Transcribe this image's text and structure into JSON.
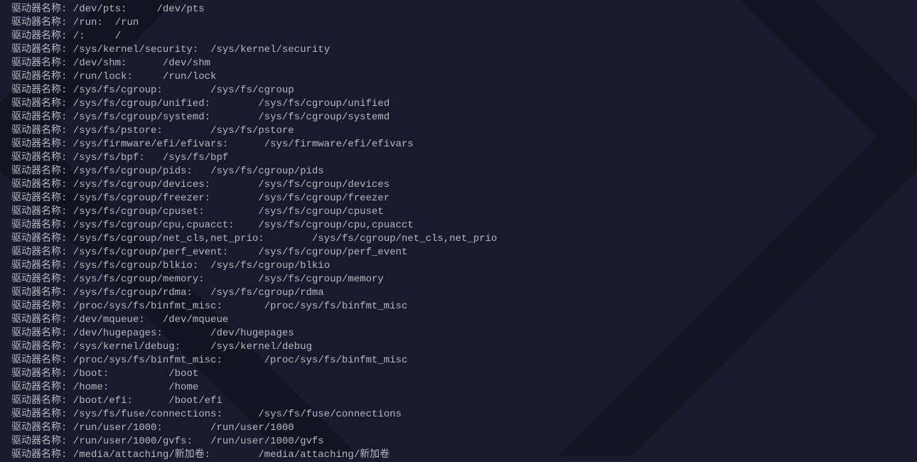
{
  "label_prefix": "驱动器名称:",
  "lines": [
    {
      "p1": "/dev/pts:",
      "pad": 5,
      "p2": "/dev/pts"
    },
    {
      "p1": "/run:",
      "pad": 2,
      "p2": "/run"
    },
    {
      "p1": "/:",
      "pad": 5,
      "p2": "/"
    },
    {
      "p1": "/sys/kernel/security:",
      "pad": 2,
      "p2": "/sys/kernel/security"
    },
    {
      "p1": "/dev/shm:",
      "pad": 6,
      "p2": "/dev/shm"
    },
    {
      "p1": "/run/lock:",
      "pad": 5,
      "p2": "/run/lock"
    },
    {
      "p1": "/sys/fs/cgroup:",
      "pad": 8,
      "p2": "/sys/fs/cgroup"
    },
    {
      "p1": "/sys/fs/cgroup/unified:",
      "pad": 8,
      "p2": "/sys/fs/cgroup/unified"
    },
    {
      "p1": "/sys/fs/cgroup/systemd:",
      "pad": 8,
      "p2": "/sys/fs/cgroup/systemd"
    },
    {
      "p1": "/sys/fs/pstore:",
      "pad": 8,
      "p2": "/sys/fs/pstore"
    },
    {
      "p1": "/sys/firmware/efi/efivars:",
      "pad": 6,
      "p2": "/sys/firmware/efi/efivars"
    },
    {
      "p1": "/sys/fs/bpf:",
      "pad": 3,
      "p2": "/sys/fs/bpf"
    },
    {
      "p1": "/sys/fs/cgroup/pids:",
      "pad": 3,
      "p2": "/sys/fs/cgroup/pids"
    },
    {
      "p1": "/sys/fs/cgroup/devices:",
      "pad": 8,
      "p2": "/sys/fs/cgroup/devices"
    },
    {
      "p1": "/sys/fs/cgroup/freezer:",
      "pad": 8,
      "p2": "/sys/fs/cgroup/freezer"
    },
    {
      "p1": "/sys/fs/cgroup/cpuset:",
      "pad": 9,
      "p2": "/sys/fs/cgroup/cpuset"
    },
    {
      "p1": "/sys/fs/cgroup/cpu,cpuacct:",
      "pad": 4,
      "p2": "/sys/fs/cgroup/cpu,cpuacct"
    },
    {
      "p1": "/sys/fs/cgroup/net_cls,net_prio:",
      "pad": 8,
      "p2": "/sys/fs/cgroup/net_cls,net_prio"
    },
    {
      "p1": "/sys/fs/cgroup/perf_event:",
      "pad": 5,
      "p2": "/sys/fs/cgroup/perf_event"
    },
    {
      "p1": "/sys/fs/cgroup/blkio:",
      "pad": 2,
      "p2": "/sys/fs/cgroup/blkio"
    },
    {
      "p1": "/sys/fs/cgroup/memory:",
      "pad": 9,
      "p2": "/sys/fs/cgroup/memory"
    },
    {
      "p1": "/sys/fs/cgroup/rdma:",
      "pad": 3,
      "p2": "/sys/fs/cgroup/rdma"
    },
    {
      "p1": "/proc/sys/fs/binfmt_misc:",
      "pad": 7,
      "p2": "/proc/sys/fs/binfmt_misc"
    },
    {
      "p1": "/dev/mqueue:",
      "pad": 3,
      "p2": "/dev/mqueue"
    },
    {
      "p1": "/dev/hugepages:",
      "pad": 8,
      "p2": "/dev/hugepages"
    },
    {
      "p1": "/sys/kernel/debug:",
      "pad": 5,
      "p2": "/sys/kernel/debug"
    },
    {
      "p1": "/proc/sys/fs/binfmt_misc:",
      "pad": 7,
      "p2": "/proc/sys/fs/binfmt_misc"
    },
    {
      "p1": "/boot:",
      "pad": 10,
      "p2": "/boot"
    },
    {
      "p1": "/home:",
      "pad": 10,
      "p2": "/home"
    },
    {
      "p1": "/boot/efi:",
      "pad": 6,
      "p2": "/boot/efi"
    },
    {
      "p1": "/sys/fs/fuse/connections:",
      "pad": 6,
      "p2": "/sys/fs/fuse/connections"
    },
    {
      "p1": "/run/user/1000:",
      "pad": 8,
      "p2": "/run/user/1000"
    },
    {
      "p1": "/run/user/1000/gvfs:",
      "pad": 3,
      "p2": "/run/user/1000/gvfs"
    },
    {
      "p1": "/media/attaching/新加卷:",
      "pad": 8,
      "p2": "/media/attaching/新加卷"
    }
  ]
}
